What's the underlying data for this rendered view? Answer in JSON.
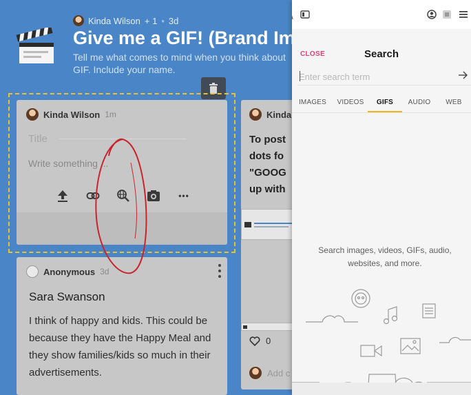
{
  "board": {
    "author": "Kinda Wilson",
    "collaborators": "+ 1",
    "separator": "•",
    "age": "3d",
    "title": "Give me a GIF! (Brand Images)",
    "description_line1": "Tell me what comes to mind when you think about",
    "description_line2": "GIF. Include your name."
  },
  "editor": {
    "author": "Kinda Wilson",
    "time": "1m",
    "title_placeholder": "Title",
    "body_placeholder": "Write something ...",
    "tools": [
      "upload-icon",
      "link-icon",
      "web-search-icon",
      "camera-icon",
      "more-icon"
    ],
    "more_label": "•••"
  },
  "posts": [
    {
      "author": "Anonymous",
      "time": "3d",
      "subject": "Sara Swanson",
      "body": "I think of happy and kids. This could be because they have the Happy Meal and they show families/kids so much in their advertisements."
    },
    {
      "author": "Kinda",
      "body_lines": [
        "To post",
        "dots fo",
        "\"GOOG",
        "up with"
      ],
      "likes": "0",
      "comment_placeholder": "Add c"
    }
  ],
  "search_panel": {
    "close_label": "CLOSE",
    "title": "Search",
    "input_placeholder": "Enter search term",
    "tabs": [
      "IMAGES",
      "VIDEOS",
      "GIFS",
      "AUDIO",
      "WEB"
    ],
    "active_tab": "GIFS",
    "empty_message": "Search images, videos, GIFs, audio, websites, and more."
  },
  "colors": {
    "board_bg": "#4a86c7",
    "card_bg": "#c7c7c7",
    "accent_close": "#e0407a",
    "tab_underline": "#f1b51c",
    "dashed_outline": "#e9c22f",
    "annotation": "#c8252e"
  }
}
